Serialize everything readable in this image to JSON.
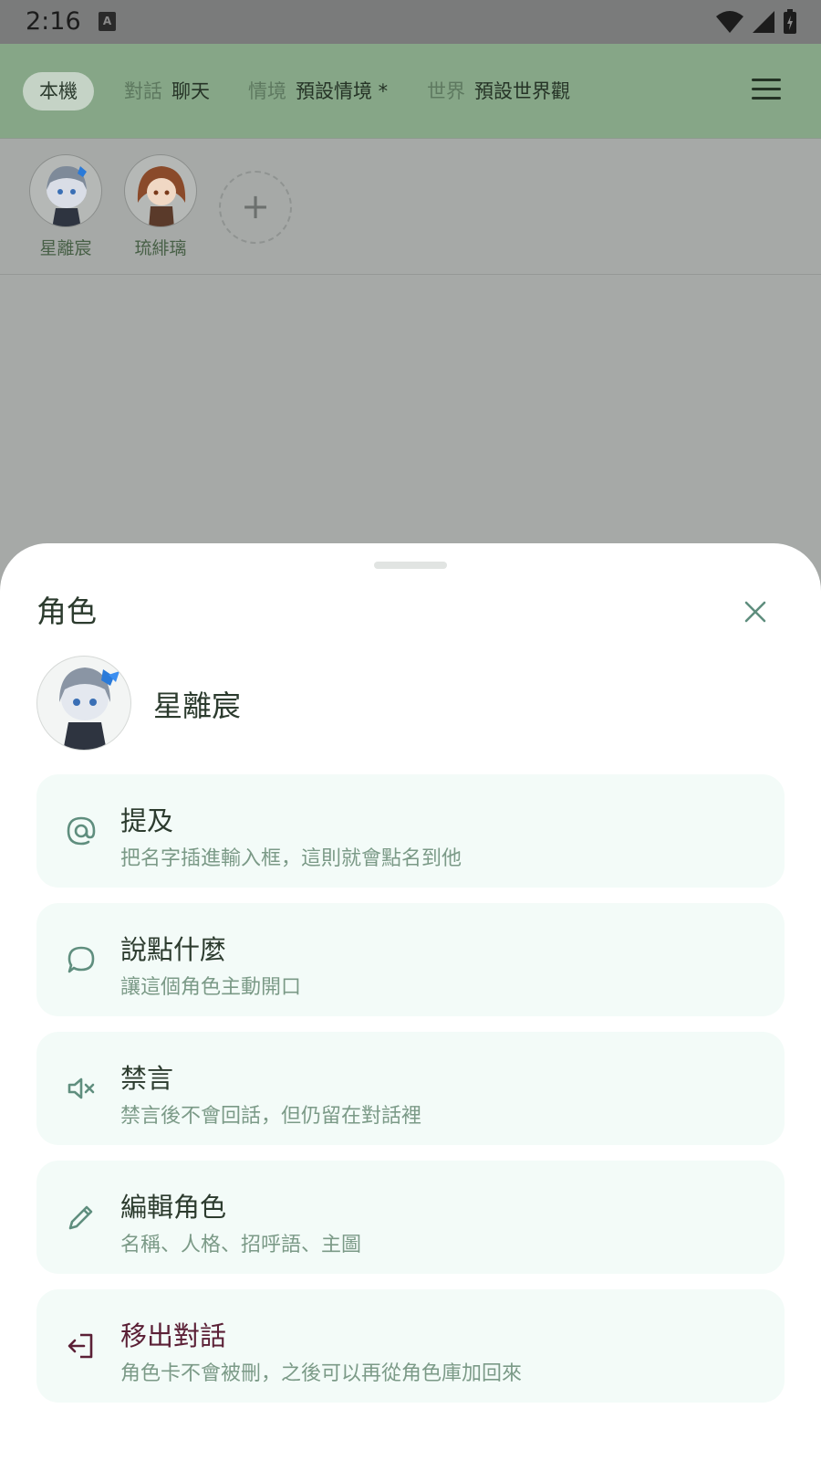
{
  "status_bar": {
    "time": "2:16",
    "notification_badge": "A"
  },
  "top_bar": {
    "local_chip": "本機",
    "contexts": [
      {
        "key": "對話",
        "value": "聊天"
      },
      {
        "key": "情境",
        "value": "預設情境 *"
      },
      {
        "key": "世界",
        "value": "預設世界觀"
      }
    ]
  },
  "characters": [
    {
      "name": "星離宸",
      "avatar_icon": "silver-haired-hooded-character-avatar"
    },
    {
      "name": "琉緋璃",
      "avatar_icon": "brown-haired-character-avatar"
    }
  ],
  "add_character_icon": "+",
  "sheet": {
    "title": "角色",
    "close_icon": "close-icon",
    "character_name": "星離宸",
    "actions": [
      {
        "id": "mention",
        "icon": "at-icon",
        "title": "提及",
        "description": "把名字插進輸入框，這則就會點名到他"
      },
      {
        "id": "speak",
        "icon": "chat-bubble-icon",
        "title": "說點什麼",
        "description": "讓這個角色主動開口"
      },
      {
        "id": "mute",
        "icon": "mute-icon",
        "title": "禁言",
        "description": "禁言後不會回話，但仍留在對話裡"
      },
      {
        "id": "edit",
        "icon": "pencil-icon",
        "title": "編輯角色",
        "description": "名稱、人格、招呼語、主圖"
      },
      {
        "id": "remove",
        "icon": "exit-icon",
        "title": "移出對話",
        "description": "角色卡不會被刪，之後可以再從角色庫加回來"
      }
    ]
  },
  "colors": {
    "top_bar": "#86a687",
    "sheet_bg": "#ffffff",
    "card_bg": "#f3fbf8",
    "icon_teal": "#5f8e7e",
    "danger": "#5b2036"
  }
}
